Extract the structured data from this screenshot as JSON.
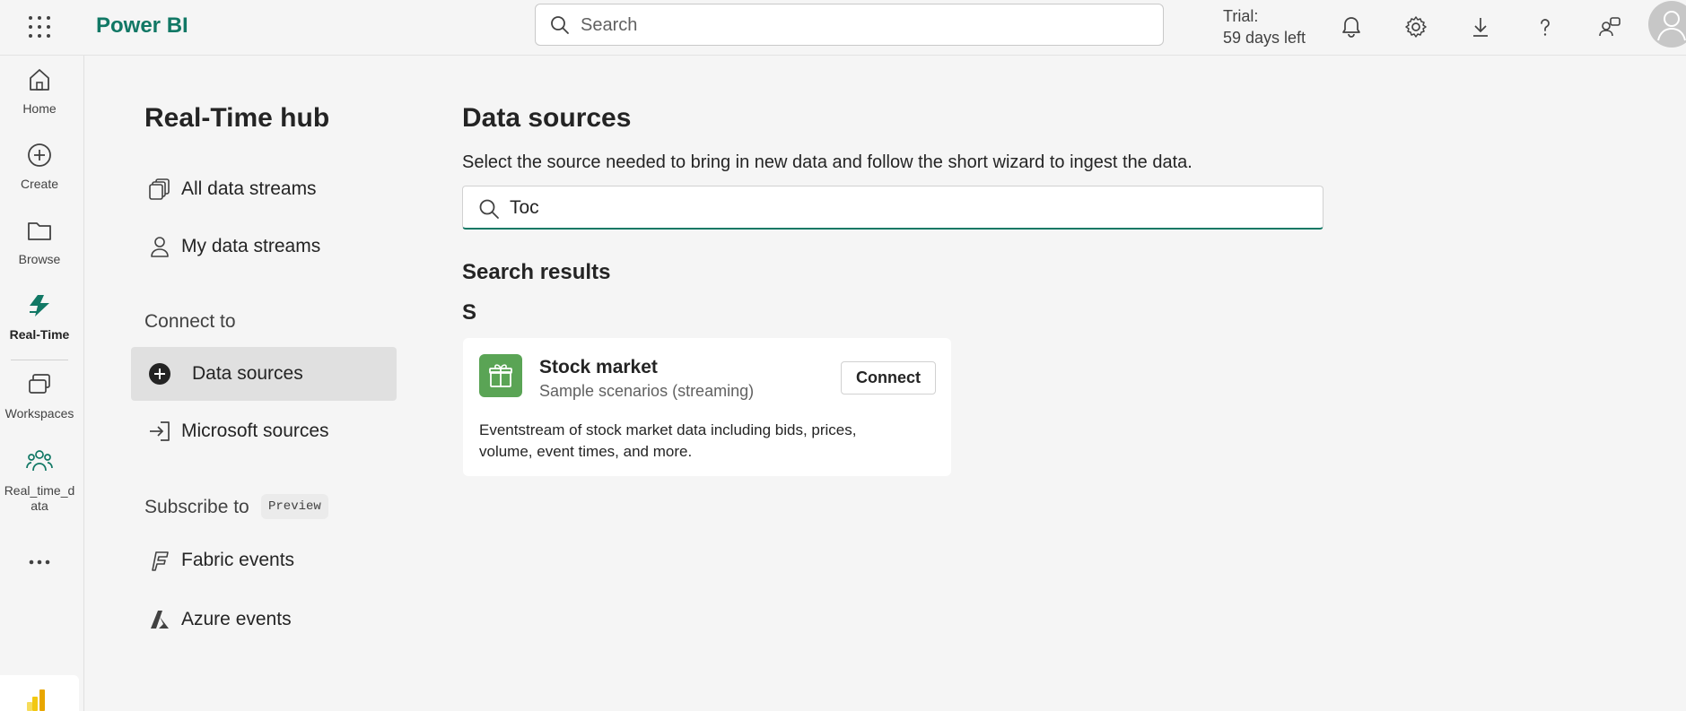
{
  "topbar": {
    "app_name": "Power BI",
    "search_placeholder": "Search",
    "trial_line1": "Trial:",
    "trial_line2": "59 days left",
    "brand_color": "#117865"
  },
  "rail": {
    "items": [
      {
        "label": "Home",
        "icon": "home-icon"
      },
      {
        "label": "Create",
        "icon": "plus-circle-icon"
      },
      {
        "label": "Browse",
        "icon": "folder-icon"
      },
      {
        "label": "Real-Time",
        "icon": "real-time-icon",
        "active": true
      },
      {
        "label": "Workspaces",
        "icon": "workspaces-icon"
      },
      {
        "label": "Real_time_d\nata",
        "icon": "people-icon"
      },
      {
        "label": "...",
        "icon": "more-icon"
      }
    ]
  },
  "hub": {
    "title": "Real-Time hub",
    "nav": [
      {
        "label": "All data streams",
        "icon": "data-streams-icon"
      },
      {
        "label": "My data streams",
        "icon": "person-icon"
      }
    ],
    "connect_to": "Connect to",
    "connect_items": [
      {
        "label": "Data sources",
        "icon": "add-circle-icon",
        "selected": true
      },
      {
        "label": "Microsoft sources",
        "icon": "sign-in-icon"
      }
    ],
    "subscribe_to": "Subscribe to",
    "preview_badge": "Preview",
    "subscribe_items": [
      {
        "label": "Fabric events",
        "icon": "fabric-icon"
      },
      {
        "label": "Azure events",
        "icon": "azure-icon"
      }
    ]
  },
  "data_sources": {
    "title": "Data sources",
    "description": "Select the source needed to bring in new data and follow the short wizard to ingest the data.",
    "search_value": "Toc",
    "results_heading": "Search results",
    "group_letter": "S",
    "card": {
      "title": "Stock market",
      "subtitle": "Sample scenarios (streaming)",
      "button": "Connect",
      "description": "Eventstream of stock market data including bids, prices, volume, event times, and more.",
      "icon": "gift-icon",
      "icon_color": "#5aa455"
    }
  }
}
